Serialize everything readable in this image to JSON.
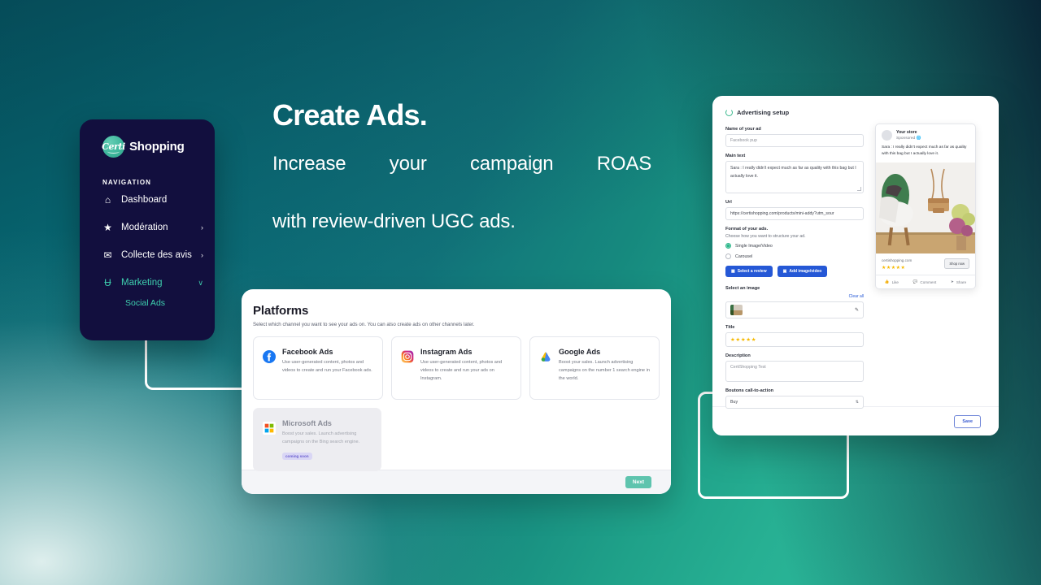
{
  "hero": {
    "title": "Create Ads.",
    "subtitle_line1": "Increase your campaign ROAS",
    "subtitle_line2": "with review-driven UGC ads."
  },
  "sidebar": {
    "logo_mark": "Certi",
    "logo_text": "Shopping",
    "nav_title": "NAVIGATION",
    "items": [
      {
        "icon": "home-icon",
        "glyph": "⌂",
        "label": "Dashboard",
        "chevron": "",
        "active": false
      },
      {
        "icon": "star-icon",
        "glyph": "★",
        "label": "Modération",
        "chevron": "›",
        "active": false
      },
      {
        "icon": "message-icon",
        "glyph": "✉",
        "label": "Collecte des avis",
        "chevron": "›",
        "active": false
      },
      {
        "icon": "megaphone-icon",
        "glyph": "Ʉ",
        "label": "Marketing",
        "chevron": "∨",
        "active": true
      }
    ],
    "sub_item": "Social Ads"
  },
  "platforms": {
    "title": "Platforms",
    "subtitle": "Select which channel you want to see your ads on. You can also create ads on other channels later.",
    "cards": [
      {
        "icon": "facebook-icon",
        "name": "Facebook Ads",
        "description": "Use user-generated content, photos and videos to create and run your Facebook ads.",
        "badge": "",
        "disabled": false
      },
      {
        "icon": "instagram-icon",
        "name": "Instagram Ads",
        "description": "Use user-generated content, photos and videos to create and run your ads on Instagram.",
        "badge": "",
        "disabled": false
      },
      {
        "icon": "google-icon",
        "name": "Google Ads",
        "description": "Boost your sales. Launch advertising campaigns on the number 1 search engine in the world.",
        "badge": "",
        "disabled": false
      },
      {
        "icon": "microsoft-icon",
        "name": "Microsoft Ads",
        "description": "Boost your sales. Launch advertising campaigns on the Bing search engine.",
        "badge": "coming soon",
        "disabled": true
      }
    ],
    "next_label": "Next"
  },
  "advertising_setup": {
    "header": "Advertising setup",
    "name_label": "Name of your ad",
    "name_value": "Facebook pup",
    "main_text_label": "Main text",
    "main_text_value": "Sara : I really didn't expect much as far as quality with this bag but I actually love it.",
    "url_label": "Url",
    "url_value": "https://certishopping.com/products/mini-addy?utm_sour",
    "format_label": "Format of your ads.",
    "format_note": "Choose how you want to structure your ad.",
    "radio_single": "Single Image/Video",
    "radio_carousel": "Carousel",
    "select_review_button": "Select a review",
    "add_image_button": "Add image/video",
    "select_image_label": "Select an image",
    "clear_all": "Clear all",
    "edit_icon": "pencil-icon",
    "title_label": "Title",
    "title_stars": "★★★★★",
    "description_label": "Description",
    "description_value": "CertiShopping Test",
    "cta_label": "Boutons call-to-action",
    "cta_value": "Buy",
    "save_label": "Save"
  },
  "ad_preview": {
    "store_name": "Your store",
    "sponsored": "Sponsored",
    "globe_icon": "globe-icon",
    "ad_copy": "Sara : I really didn't expect much as far as quality with this bag but I actually love it.",
    "domain": "certishopping.com",
    "stars": "★★★★★",
    "shop_now": "Shop now",
    "actions": [
      {
        "icon": "thumbs-up-icon",
        "glyph": "☝",
        "label": "Like"
      },
      {
        "icon": "comment-icon",
        "glyph": "▭",
        "label": "Comment"
      },
      {
        "icon": "share-icon",
        "glyph": "➦",
        "label": "Share"
      }
    ]
  },
  "colors": {
    "brand_teal": "#2fbda0",
    "sidebar_navy": "#120f3e",
    "accent_green": "#3ecfae",
    "blue_button": "#2558d6",
    "star_gold": "#f6b900",
    "badge_purple": "#6b5fd0"
  }
}
